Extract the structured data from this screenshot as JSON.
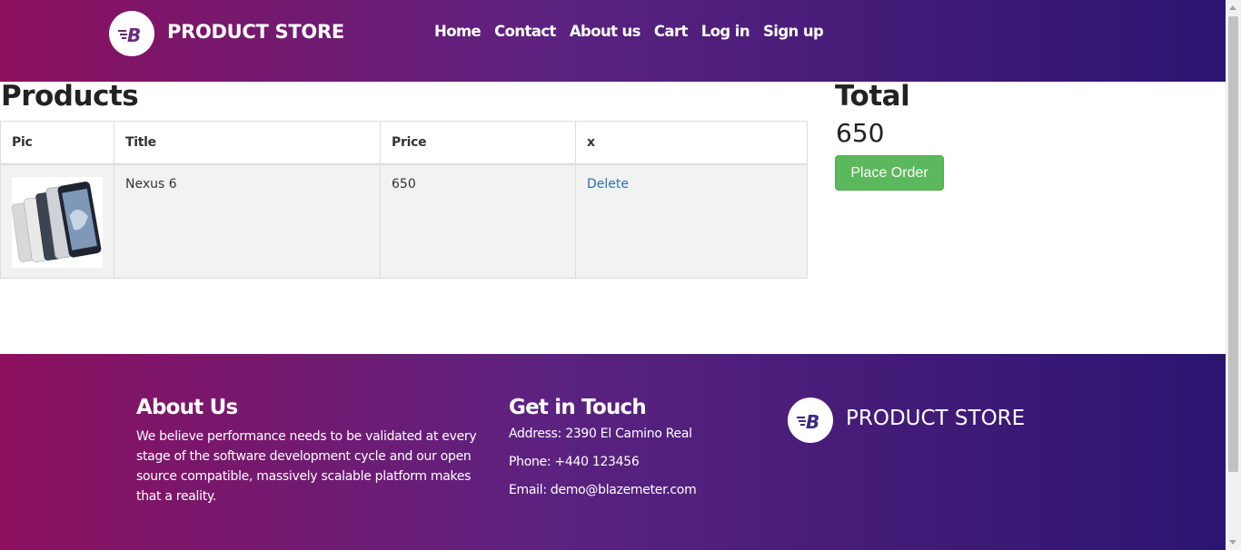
{
  "colors": {
    "brand_start": "#8c105f",
    "brand_end": "#2a1570",
    "button_green": "#5cb85c",
    "link_blue": "#2a6dbf"
  },
  "navbar": {
    "brand": "PRODUCT STORE",
    "links": [
      "Home",
      "Contact",
      "About us",
      "Cart",
      "Log in",
      "Sign up"
    ]
  },
  "products": {
    "title": "Products",
    "headers": [
      "Pic",
      "Title",
      "Price",
      "x"
    ],
    "rows": [
      {
        "pic": "nexus-6-phones-image",
        "title": "Nexus 6",
        "price": "650",
        "action": "Delete"
      }
    ]
  },
  "total": {
    "title": "Total",
    "value": "650",
    "button": "Place Order"
  },
  "footer": {
    "about_title": "About Us",
    "about_text": "We believe performance needs to be validated at every stage of the software development cycle and our open source compatible, massively scalable platform makes that a reality.",
    "contact_title": "Get in Touch",
    "address": "Address: 2390 El Camino Real",
    "phone": "Phone: +440 123456",
    "email": "Email: demo@blazemeter.com",
    "brand": "PRODUCT STORE"
  }
}
